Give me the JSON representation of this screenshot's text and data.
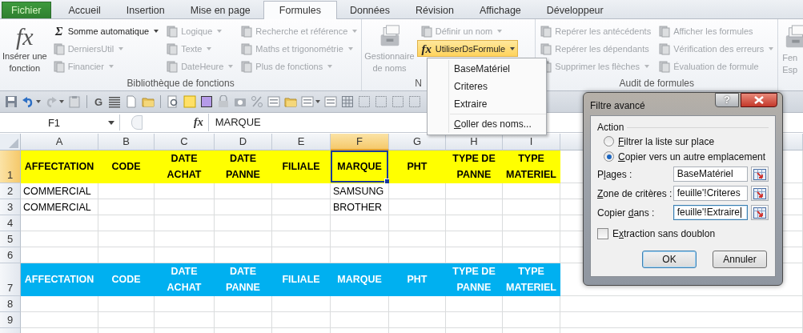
{
  "tabs": [
    {
      "label": "Fichier",
      "kind": "file",
      "selected": false
    },
    {
      "label": "Accueil",
      "kind": "tab",
      "selected": false
    },
    {
      "label": "Insertion",
      "kind": "tab",
      "selected": false
    },
    {
      "label": "Mise en page",
      "kind": "tab",
      "selected": false
    },
    {
      "label": "Formules",
      "kind": "tab",
      "selected": true
    },
    {
      "label": "Données",
      "kind": "tab",
      "selected": false
    },
    {
      "label": "Révision",
      "kind": "tab",
      "selected": false
    },
    {
      "label": "Affichage",
      "kind": "tab",
      "selected": false
    },
    {
      "label": "Développeur",
      "kind": "tab",
      "selected": false
    }
  ],
  "ribbon": {
    "groups": [
      {
        "label": "Bibliothèque de fonctions",
        "controls": [
          {
            "kind": "large",
            "glyph": "fx",
            "lines": [
              "Insérer une",
              "fonction"
            ],
            "disabled": false
          },
          {
            "kind": "stack",
            "items": [
              {
                "label": "Somme automatique",
                "glyph": "Σ",
                "disabled": false,
                "dropdown": true,
                "highlighted": false
              },
              {
                "label": "DerniersUtil",
                "disabled": true,
                "dropdown": true,
                "highlighted": false
              },
              {
                "label": "Financier",
                "disabled": true,
                "dropdown": true,
                "highlighted": false
              }
            ]
          },
          {
            "kind": "stack",
            "items": [
              {
                "label": "Logique",
                "disabled": true,
                "dropdown": true,
                "highlighted": false
              },
              {
                "label": "Texte",
                "disabled": true,
                "dropdown": true,
                "highlighted": false
              },
              {
                "label": "DateHeure",
                "disabled": true,
                "dropdown": true,
                "highlighted": false
              }
            ]
          },
          {
            "kind": "stack",
            "items": [
              {
                "label": "Recherche et référence",
                "disabled": true,
                "dropdown": true,
                "highlighted": false
              },
              {
                "label": "Maths et trigonométrie",
                "disabled": true,
                "dropdown": true,
                "highlighted": false
              },
              {
                "label": "Plus de fonctions",
                "disabled": true,
                "dropdown": true,
                "highlighted": false
              }
            ]
          }
        ]
      },
      {
        "label": "N",
        "controls": [
          {
            "kind": "large",
            "lines": [
              "Gestionnaire",
              "de noms"
            ],
            "disabled": true
          },
          {
            "kind": "stack",
            "items": [
              {
                "label": "Définir un nom",
                "disabled": true,
                "dropdown": true,
                "highlighted": false
              },
              {
                "label": "UtiliserDsFormule",
                "glyph": "fx",
                "disabled": false,
                "dropdown": true,
                "highlighted": true
              }
            ]
          }
        ]
      },
      {
        "label": "Audit de formules",
        "controls": [
          {
            "kind": "stack",
            "items": [
              {
                "label": "Repérer les antécédents",
                "disabled": true,
                "dropdown": false,
                "highlighted": false
              },
              {
                "label": "Repérer les dépendants",
                "disabled": true,
                "dropdown": false,
                "highlighted": false
              },
              {
                "label": "Supprimer les flèches",
                "disabled": true,
                "dropdown": true,
                "highlighted": false
              }
            ]
          },
          {
            "kind": "stack",
            "items": [
              {
                "label": "Afficher les formules",
                "disabled": true,
                "dropdown": false,
                "highlighted": false
              },
              {
                "label": "Vérification des erreurs",
                "disabled": true,
                "dropdown": true,
                "highlighted": false
              },
              {
                "label": "Évaluation de formule",
                "disabled": true,
                "dropdown": false,
                "highlighted": false
              }
            ]
          }
        ]
      },
      {
        "controls": [
          {
            "kind": "large",
            "lines": [
              "Fen",
              "Esp"
            ],
            "disabled": true
          }
        ]
      }
    ]
  },
  "quick_toolbar": {
    "bold_label": "G"
  },
  "formula_bar": {
    "name_box": "F1",
    "fx": "fx",
    "content": "MARQUE"
  },
  "sheet": {
    "columns": [
      {
        "letter": "A",
        "selected": false
      },
      {
        "letter": "B",
        "selected": false
      },
      {
        "letter": "C",
        "selected": false
      },
      {
        "letter": "D",
        "selected": false
      },
      {
        "letter": "E",
        "selected": false
      },
      {
        "letter": "F",
        "selected": true
      },
      {
        "letter": "G",
        "selected": false
      },
      {
        "letter": "H",
        "selected": false
      },
      {
        "letter": "I",
        "selected": false
      }
    ],
    "rows": [
      {
        "number": "1",
        "kind": "double",
        "selected": true,
        "color": "#ffff00",
        "cells": [
          "AFFECTATION",
          "CODE",
          "DATE ACHAT",
          "DATE PANNE",
          "FILIALE",
          "MARQUE",
          "PHT",
          "TYPE DE PANNE",
          "TYPE MATERIEL"
        ]
      },
      {
        "number": "2",
        "kind": "single",
        "selected": false,
        "cells": [
          "COMMERCIAL",
          null,
          null,
          null,
          null,
          "SAMSUNG",
          null,
          null,
          null
        ]
      },
      {
        "number": "3",
        "kind": "single",
        "selected": false,
        "cells": [
          "COMMERCIAL",
          null,
          null,
          null,
          null,
          "BROTHER",
          null,
          null,
          null
        ]
      },
      {
        "number": "4",
        "kind": "single",
        "selected": false,
        "cells": [
          null,
          null,
          null,
          null,
          null,
          null,
          null,
          null,
          null
        ]
      },
      {
        "number": "5",
        "kind": "single",
        "selected": false,
        "cells": [
          null,
          null,
          null,
          null,
          null,
          null,
          null,
          null,
          null
        ]
      },
      {
        "number": "6",
        "kind": "single",
        "selected": false,
        "cells": [
          null,
          null,
          null,
          null,
          null,
          null,
          null,
          null,
          null
        ]
      },
      {
        "number": "7",
        "kind": "double",
        "selected": false,
        "color": "#00b0f0",
        "cells": [
          "AFFECTATION",
          "CODE",
          "DATE ACHAT",
          "DATE PANNE",
          "FILIALE",
          "MARQUE",
          "PHT",
          "TYPE DE PANNE",
          "TYPE MATERIEL"
        ]
      },
      {
        "number": "8",
        "kind": "single",
        "selected": false,
        "cells": [
          null,
          null,
          null,
          null,
          null,
          null,
          null,
          null,
          null
        ]
      },
      {
        "number": "9",
        "kind": "single",
        "selected": false,
        "cells": [
          null,
          null,
          null,
          null,
          null,
          null,
          null,
          null,
          null
        ]
      }
    ]
  },
  "menu": {
    "items": [
      {
        "kind": "item",
        "parts": [
          {
            "text": "BaseMatériel",
            "underline": false
          }
        ]
      },
      {
        "kind": "item",
        "parts": [
          {
            "text": "Criteres",
            "underline": false
          }
        ]
      },
      {
        "kind": "item",
        "parts": [
          {
            "text": "Extraire",
            "underline": false
          }
        ]
      },
      {
        "kind": "separator"
      },
      {
        "kind": "item",
        "parts": [
          {
            "text": "C",
            "underline": true
          },
          {
            "text": "oller des noms...",
            "underline": false
          }
        ]
      }
    ]
  },
  "dialog": {
    "title": "Filtre avancé",
    "help": "?",
    "legend": "Action",
    "options": [
      {
        "parts": [
          {
            "text": "F",
            "underline": true
          },
          {
            "text": "iltrer la liste sur place",
            "underline": false
          }
        ],
        "selected": false
      },
      {
        "parts": [
          {
            "text": "C",
            "underline": true
          },
          {
            "text": "opier vers un autre emplacement",
            "underline": false
          }
        ],
        "selected": true
      }
    ],
    "fields": [
      {
        "parts": [
          {
            "text": "P",
            "underline": false
          },
          {
            "text": "l",
            "underline": true
          },
          {
            "text": "ages :",
            "underline": false
          }
        ],
        "value": "BaseMatériel",
        "focused": false
      },
      {
        "parts": [
          {
            "text": "Z",
            "underline": true
          },
          {
            "text": "one de critères :",
            "underline": false
          }
        ],
        "value": "feuille'!Criteres",
        "focused": false
      },
      {
        "parts": [
          {
            "text": "Copier ",
            "underline": false
          },
          {
            "text": "d",
            "underline": true
          },
          {
            "text": "ans :",
            "underline": false
          }
        ],
        "value": "feuille'!Extraire",
        "focused": true
      }
    ],
    "unique": {
      "parts": [
        {
          "text": "E",
          "underline": false
        },
        {
          "text": "x",
          "underline": true
        },
        {
          "text": "traction sans doublon",
          "underline": false
        }
      ],
      "checked": false
    },
    "buttons": [
      {
        "label": "OK",
        "default": true
      },
      {
        "label": "Annuler",
        "default": false
      }
    ]
  }
}
